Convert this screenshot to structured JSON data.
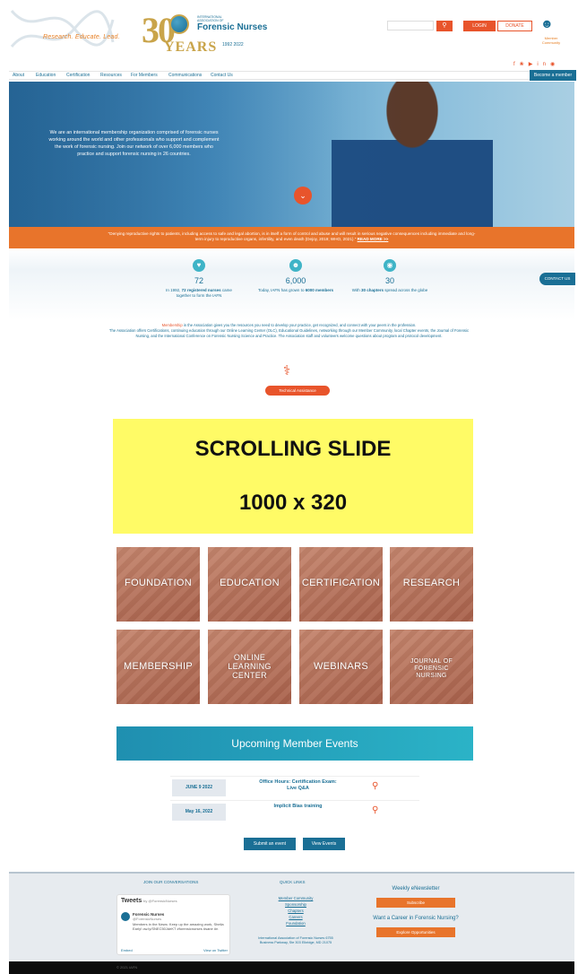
{
  "header": {
    "tagline": "Research. Educate. Lead.",
    "logo_30": "30",
    "logo_years": "YEARS",
    "logo_org_small": "INTERNATIONAL ASSOCIATION OF",
    "logo_org_name": "Forensic Nurses",
    "logo_year_range": "1992 2022",
    "search_placeholder": "",
    "login_label": "LOGIN",
    "donate_label": "DONATE",
    "community_label": "Member Community",
    "social_icons": [
      "facebook-icon",
      "twitter-icon",
      "youtube-icon",
      "linkedin-icon",
      "instagram-icon"
    ]
  },
  "nav": {
    "items": [
      "About",
      "Education",
      "Certification",
      "Resources",
      "For Members",
      "Communications",
      "Contact Us"
    ],
    "become_label": "Become a member"
  },
  "hero": {
    "text": "We are an international membership organization comprised of forensic nurses working around the world and other professionals who support and complement the work of forensic nursing. Join our network of over 6,000 members who practice and support forensic nursing in 26 countries."
  },
  "quote": {
    "text": "\"Denying reproductive rights to patients, including access to safe and legal abortion, is in itself a form of control and abuse and will result in serious negative consequences including immediate and long-term injury to reproductive organs, infertility, and even death (Dejoy, 2019; WHO, 2021).\"",
    "read_more": "READ MORE >>"
  },
  "stats": [
    {
      "num": "72",
      "text_a": "In 1992, ",
      "bold": "72 registered nurses",
      "text_b": " came together to form the IAFN"
    },
    {
      "num": "6,000",
      "text_a": "Today, IAFN has grown to ",
      "bold": "6000 members",
      "text_b": ""
    },
    {
      "num": "30",
      "text_a": "With ",
      "bold": "30 chapters",
      "text_b": " spread across the globe"
    }
  ],
  "contact_label": "CONTACT US",
  "membership_text": {
    "p1_link": "Membership",
    "p1": " in the Association gives you the resources you need to develop your practice, get recognized, and connect with your peers in the profession.",
    "p2": "The Association offers Certifications, continuing education through our Online Learning Center (OLC), Educational Guidelines, networking through our Member Community, local Chapter events, the Journal of Forensic Nursing, and the International Conference on Forensic Nursing Science and Practice. The Association staff and volunteers welcome questions about program and protocol development."
  },
  "tech_label": "Technical Assistance",
  "slide": {
    "line1": "SCROLLING SLIDE",
    "line2": "1000 x 320"
  },
  "tiles": [
    "FOUNDATION",
    "EDUCATION",
    "CERTIFICATION",
    "RESEARCH",
    "MEMBERSHIP",
    "ONLINE LEARNING CENTER",
    "WEBINARS",
    "JOURNAL OF FORENSIC NURSING"
  ],
  "events": {
    "heading": "Upcoming Member Events",
    "rows": [
      {
        "date": "JUNE 9 2022",
        "title": "Office Hours: Certification Exam: Live Q&A"
      },
      {
        "date": "May 16, 2022",
        "title": "Implicit Bias training"
      }
    ],
    "submit_label": "Submit an event",
    "view_label": "View Events"
  },
  "footer": {
    "join_heading": "JOIN OUR CONVERSATIONS",
    "tweets_title": "Tweets",
    "tweets_by": "by @ForensicNurses",
    "tweet_name": "Forensic Nurses",
    "tweet_handle": "@ForensicNurses",
    "tweet_text": "Members in the News: Keep up the amazing work, Sheila Early! ow.ly/SNEC50JdeKT #forensicnurses #sane #n",
    "embed_label": "Embed",
    "view_twitter": "View on Twitter",
    "quick_heading": "QUICK LINKS",
    "quick_links": [
      "Member Community",
      "Sponsorship",
      "Chapters",
      "Careers",
      "Foundation"
    ],
    "address": "International Association of Forensic Nurses 6755 Business Parkway, Ste 303 Elkridge, MD 21075",
    "enews_heading": "Weekly eNewsletter",
    "subscribe_label": "Subscribe",
    "career_heading": "Want a Career in Forensic Nursing?",
    "explore_label": "Explore Opportunities",
    "copyright": "© 2021 IAFN"
  }
}
